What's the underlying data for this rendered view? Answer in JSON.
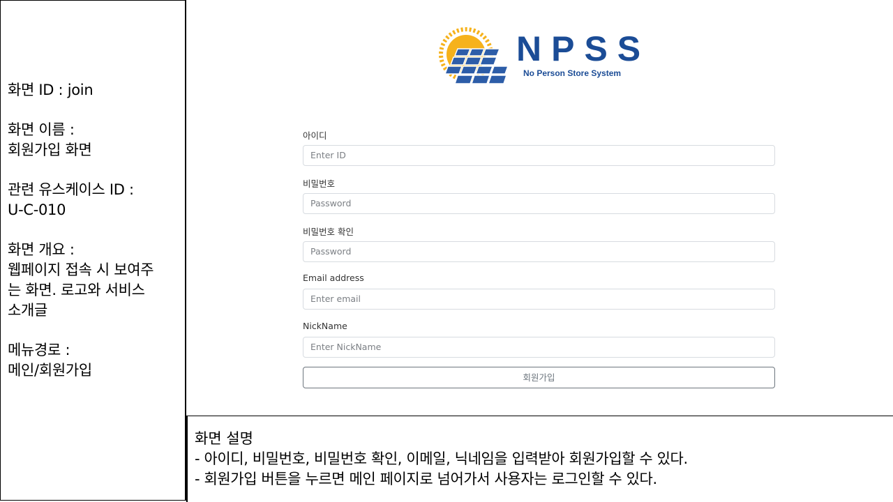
{
  "spec": {
    "screen_id": "화면 ID : join",
    "screen_name_label": "화면 이름 :",
    "screen_name_value": "회원가입 화면",
    "usecase_label": "관련 유스케이스 ID :",
    "usecase_value": "U-C-010",
    "overview_label": "화면 개요 :",
    "overview_value": "웹페이지 접속 시 보여주\n는 화면. 로고와 서비스\n소개글",
    "menu_path_label": "메뉴경로 :",
    "menu_path_value": "메인/회원가입"
  },
  "logo": {
    "title": "NPSS",
    "subtitle": "No Person Store System",
    "sun_color": "#f6b21b",
    "panel_color": "#2d5da8",
    "text_color": "#1b4c96"
  },
  "form": {
    "fields": [
      {
        "label": "아이디",
        "placeholder": "Enter ID"
      },
      {
        "label": "비밀번호",
        "placeholder": "Password"
      },
      {
        "label": "비밀번호 확인",
        "placeholder": "Password"
      },
      {
        "label": "Email address",
        "placeholder": "Enter email"
      },
      {
        "label": "NickName",
        "placeholder": "Enter NickName"
      }
    ],
    "submit_label": "회원가입"
  },
  "description": {
    "title": "화면 설명",
    "lines": [
      "- 아이디, 비밀번호, 비밀번호 확인, 이메일, 닉네임을 입력받아 회원가입할 수 있다.",
      "- 회원가입 버튼을 누르면 메인 페이지로 넘어가서 사용자는 로그인할 수 있다."
    ]
  }
}
